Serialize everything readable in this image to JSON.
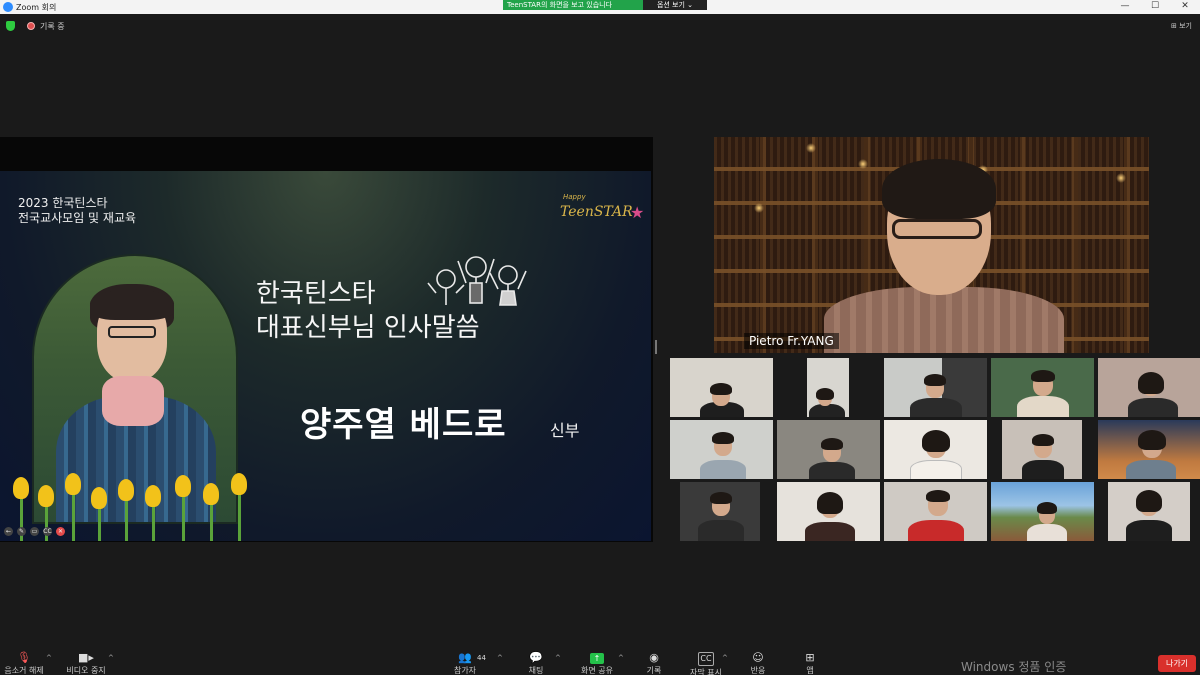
{
  "window": {
    "title": "Zoom 회의",
    "controls": [
      "—",
      "☐",
      "✕"
    ]
  },
  "share_banner": {
    "message": "TeenSTAR의 화면을 보고 있습니다",
    "options_label": "옵션 보기 ⌄"
  },
  "topbar": {
    "recording_label": "기록 중",
    "view_label": "보기"
  },
  "slide": {
    "event_title_line1": "2023 한국틴스타",
    "event_title_line2": "전국교사모임 및 재교육",
    "logo_happy": "Happy",
    "logo_teenstar": "TeenSTAR",
    "logo_star": "★",
    "heading_line1": "한국틴스타",
    "heading_line2": "대표신부님 인사말씀",
    "speaker_name": "양주열 베드로",
    "speaker_suffix": "신부",
    "ctrls": [
      "←",
      "✎",
      "▭",
      "CC",
      "✕"
    ]
  },
  "active_speaker": {
    "name": "Pietro Fr.YANG"
  },
  "toolbar": {
    "mute_label": "음소거 해제",
    "video_label": "비디오 중지",
    "participants_label": "참가자",
    "participants_count": "44",
    "chat_label": "채팅",
    "share_label": "화면 공유",
    "record_label": "기록",
    "captions_label": "자막 표시",
    "reactions_label": "반응",
    "apps_label": "앱",
    "leave_label": "나가기",
    "caret": "^"
  },
  "watermark": "Windows 정품 인증",
  "colors": {
    "share_green": "#22a34a",
    "leave_red": "#d9302c",
    "zoom_blue": "#2d8cff"
  }
}
